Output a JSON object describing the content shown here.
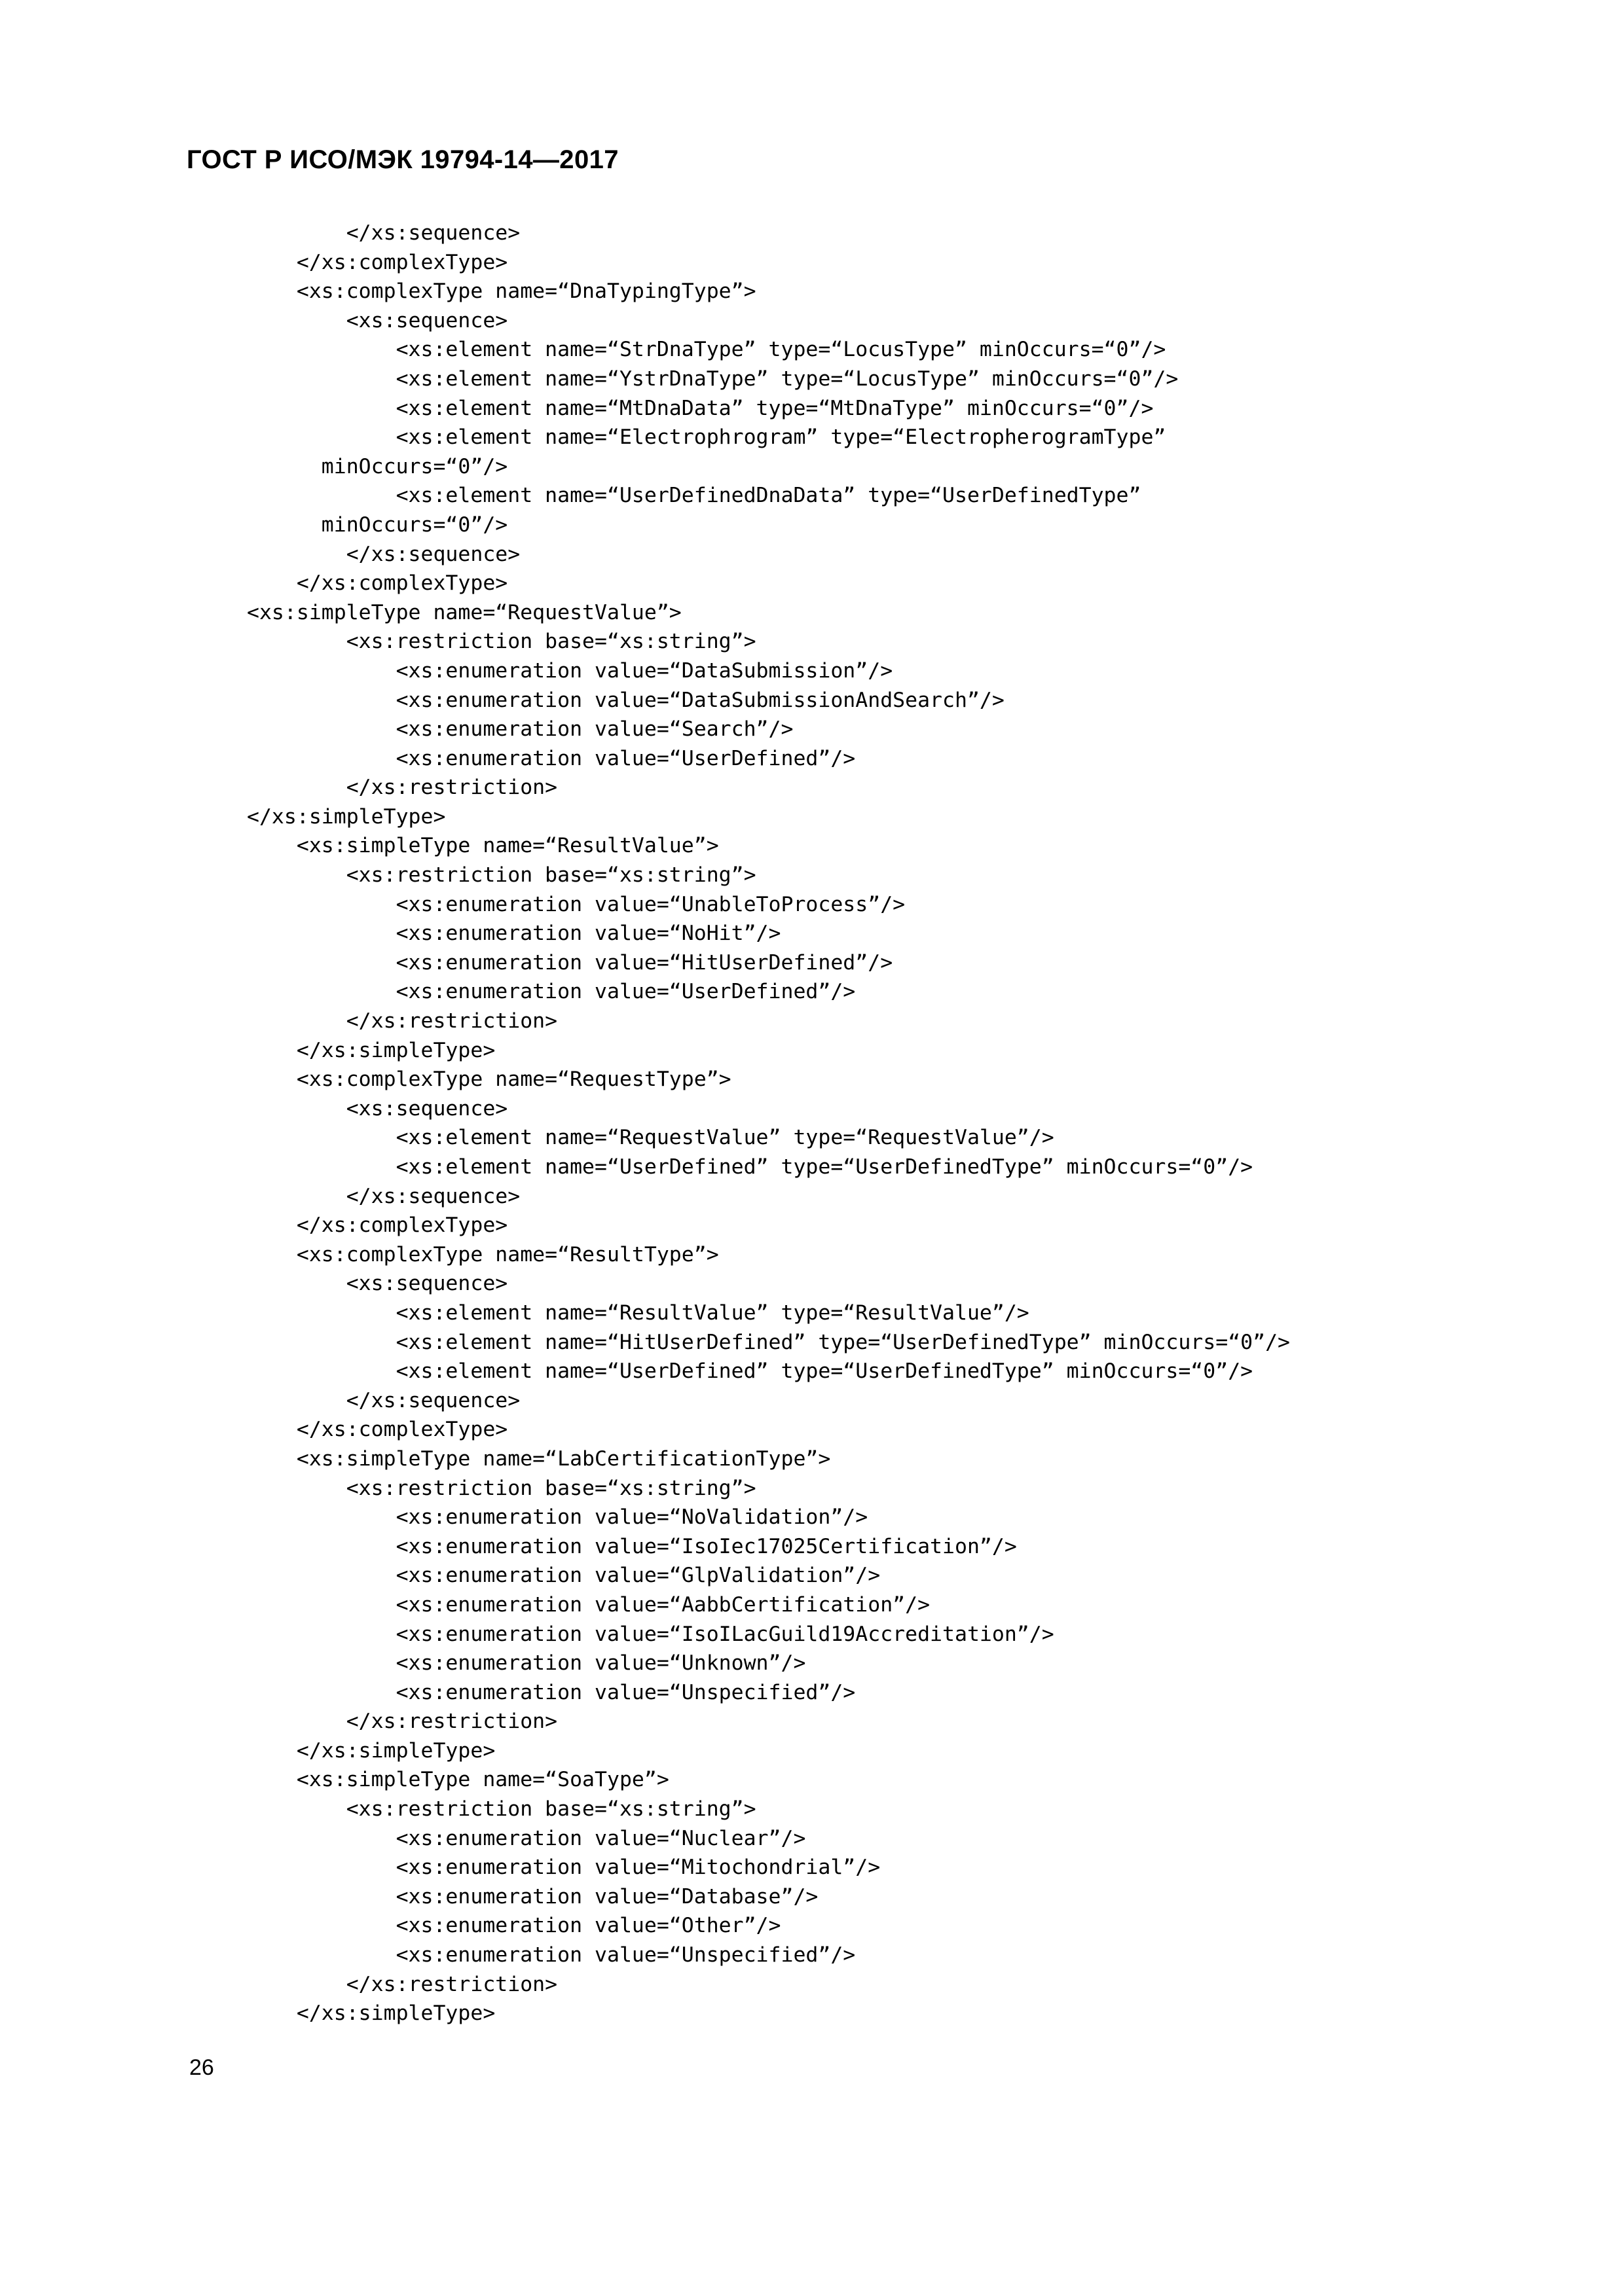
{
  "document": {
    "header": "ГОСТ Р ИСО/МЭК 19794-14—2017",
    "page_number": "26"
  },
  "code_block": {
    "language": "xml-schema",
    "lines": [
      "        </xs:sequence>",
      "    </xs:complexType>",
      "    <xs:complexType name=“DnaTypingType”>",
      "        <xs:sequence>",
      "            <xs:element name=“StrDnaType” type=“LocusType” minOccurs=“0”/>",
      "            <xs:element name=“YstrDnaType” type=“LocusType” minOccurs=“0”/>",
      "            <xs:element name=“MtDnaData” type=“MtDnaType” minOccurs=“0”/>",
      "            <xs:element name=“Electrophrogram” type=“ElectropherogramType”",
      "      minOccurs=“0”/>",
      "            <xs:element name=“UserDefinedDnaData” type=“UserDefinedType”",
      "      minOccurs=“0”/>",
      "        </xs:sequence>",
      "    </xs:complexType>",
      "<xs:simpleType name=“RequestValue”>",
      "        <xs:restriction base=“xs:string”>",
      "            <xs:enumeration value=“DataSubmission”/>",
      "            <xs:enumeration value=“DataSubmissionAndSearch”/>",
      "            <xs:enumeration value=“Search”/>",
      "            <xs:enumeration value=“UserDefined”/>",
      "        </xs:restriction>",
      "</xs:simpleType>",
      "    <xs:simpleType name=“ResultValue”>",
      "        <xs:restriction base=“xs:string”>",
      "            <xs:enumeration value=“UnableToProcess”/>",
      "            <xs:enumeration value=“NoHit”/>",
      "            <xs:enumeration value=“HitUserDefined”/>",
      "            <xs:enumeration value=“UserDefined”/>",
      "        </xs:restriction>",
      "    </xs:simpleType>",
      "    <xs:complexType name=“RequestType”>",
      "        <xs:sequence>",
      "            <xs:element name=“RequestValue” type=“RequestValue”/>",
      "            <xs:element name=“UserDefined” type=“UserDefinedType” minOccurs=“0”/>",
      "        </xs:sequence>",
      "    </xs:complexType>",
      "    <xs:complexType name=“ResultType”>",
      "        <xs:sequence>",
      "            <xs:element name=“ResultValue” type=“ResultValue”/>",
      "            <xs:element name=“HitUserDefined” type=“UserDefinedType” minOccurs=“0”/>",
      "            <xs:element name=“UserDefined” type=“UserDefinedType” minOccurs=“0”/>",
      "        </xs:sequence>",
      "    </xs:complexType>",
      "    <xs:simpleType name=“LabCertificationType”>",
      "        <xs:restriction base=“xs:string”>",
      "            <xs:enumeration value=“NoValidation”/>",
      "            <xs:enumeration value=“IsoIec17025Certification”/>",
      "            <xs:enumeration value=“GlpValidation”/>",
      "            <xs:enumeration value=“AabbCertification”/>",
      "            <xs:enumeration value=“IsoILacGuild19Accreditation”/>",
      "            <xs:enumeration value=“Unknown”/>",
      "            <xs:enumeration value=“Unspecified”/>",
      "        </xs:restriction>",
      "    </xs:simpleType>",
      "    <xs:simpleType name=“SoaType”>",
      "        <xs:restriction base=“xs:string”>",
      "            <xs:enumeration value=“Nuclear”/>",
      "            <xs:enumeration value=“Mitochondrial”/>",
      "            <xs:enumeration value=“Database”/>",
      "            <xs:enumeration value=“Other”/>",
      "            <xs:enumeration value=“Unspecified”/>",
      "        </xs:restriction>",
      "    </xs:simpleType>"
    ]
  }
}
